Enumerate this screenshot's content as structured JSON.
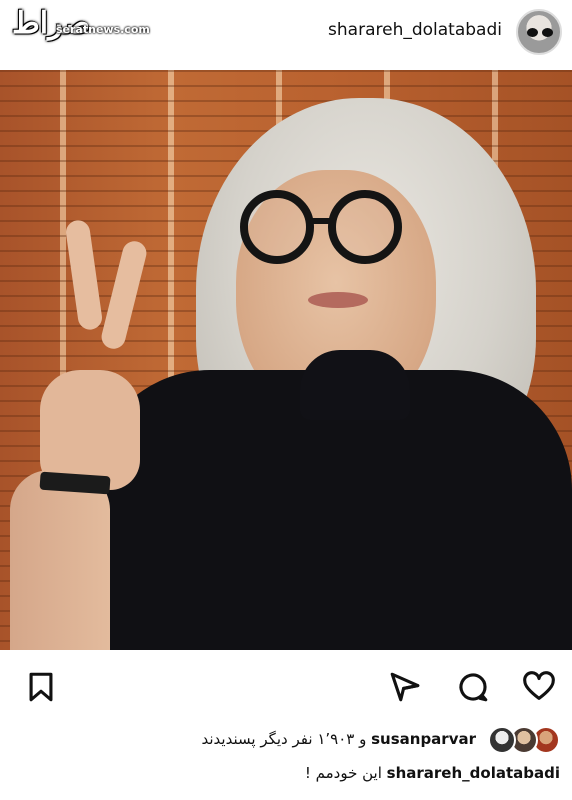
{
  "watermark": {
    "logo": "صراط",
    "site": "seratnews.com"
  },
  "header": {
    "username": "sharareh_dolatabadi"
  },
  "actions": {
    "bookmark_icon": "bookmark-icon",
    "share_icon": "send-icon",
    "comment_icon": "comment-icon",
    "like_icon": "heart-icon"
  },
  "likes": {
    "liker": "susanparvar",
    "text": "و ۱٬۹۰۳ نفر دیگر پسندیدند"
  },
  "caption": {
    "username": "sharareh_dolatabadi",
    "text": "این خودمم !",
    "second_line": "..."
  }
}
